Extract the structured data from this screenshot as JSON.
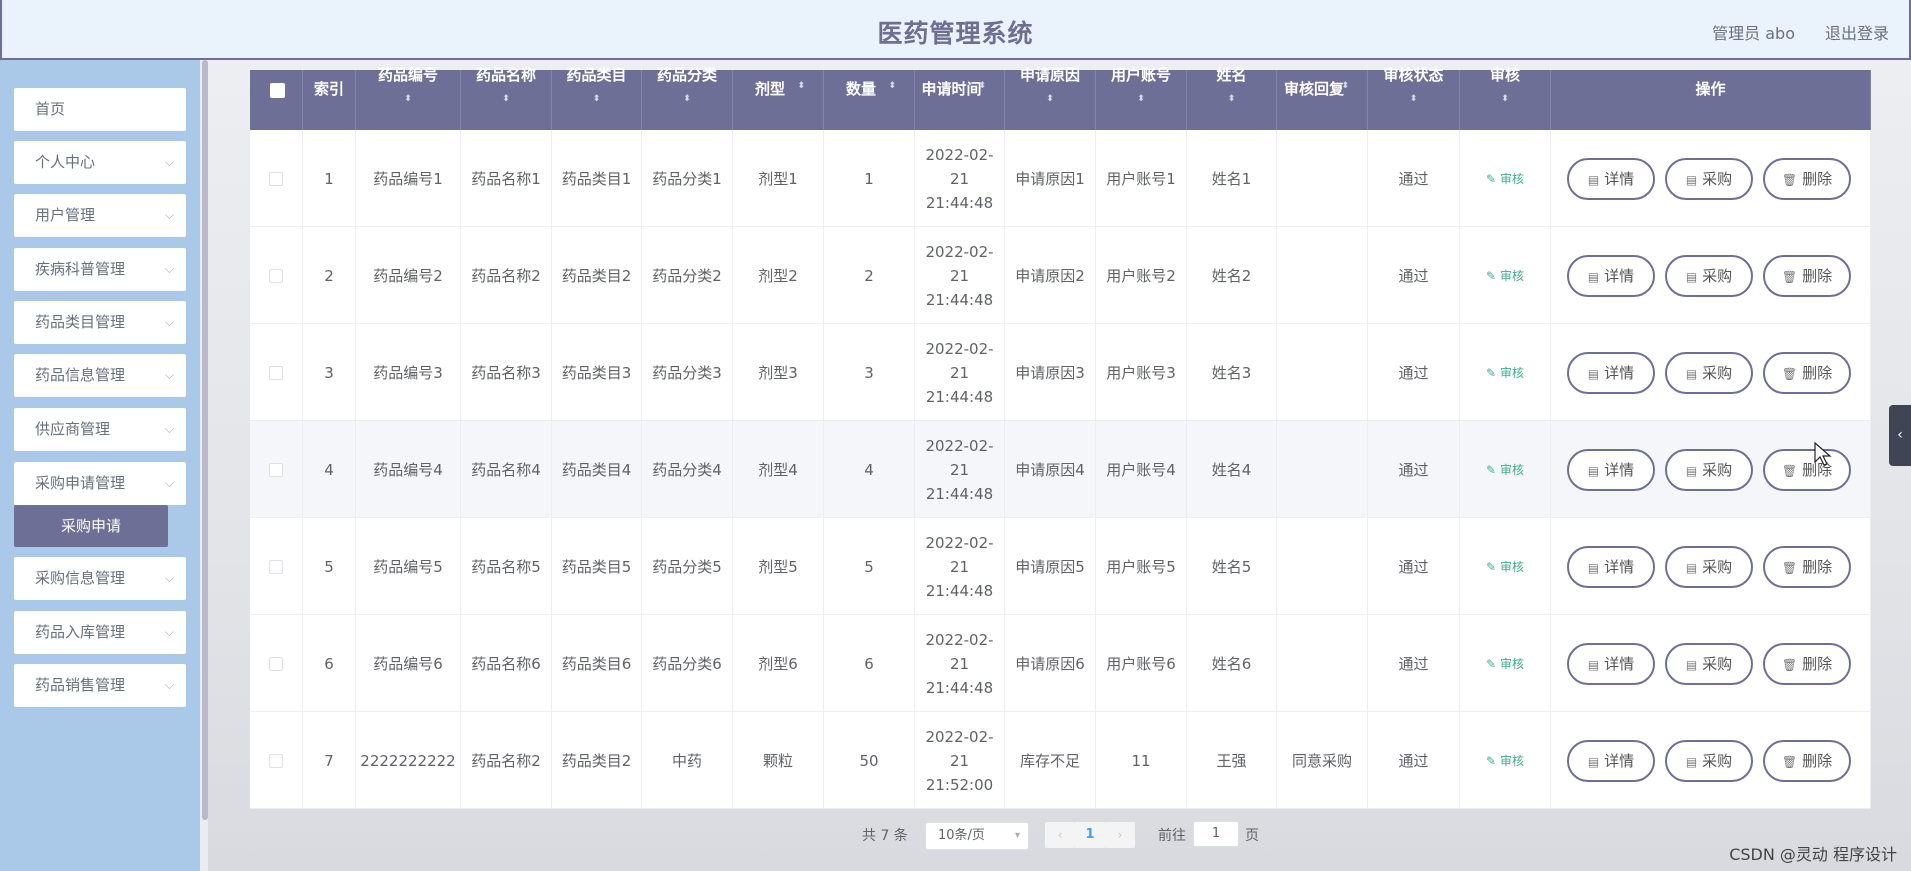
{
  "header": {
    "title": "医药管理系统",
    "user": "管理员 abo",
    "logout": "退出登录"
  },
  "sidebar": {
    "items": [
      {
        "label": "首页",
        "has_chevron": false
      },
      {
        "label": "个人中心",
        "has_chevron": true
      },
      {
        "label": "用户管理",
        "has_chevron": true
      },
      {
        "label": "疾病科普管理",
        "has_chevron": true
      },
      {
        "label": "药品类目管理",
        "has_chevron": true
      },
      {
        "label": "药品信息管理",
        "has_chevron": true
      },
      {
        "label": "供应商管理",
        "has_chevron": true
      },
      {
        "label": "采购申请管理",
        "has_chevron": true
      },
      {
        "label": "采购信息管理",
        "has_chevron": true
      },
      {
        "label": "药品入库管理",
        "has_chevron": true
      },
      {
        "label": "药品销售管理",
        "has_chevron": true
      }
    ],
    "active_sub": "采购申请"
  },
  "table": {
    "columns": [
      {
        "label": "索引",
        "sortable": false
      },
      {
        "label": "药品编号",
        "sortable": true
      },
      {
        "label": "药品名称",
        "sortable": true
      },
      {
        "label": "药品类目",
        "sortable": true
      },
      {
        "label": "药品分类",
        "sortable": true
      },
      {
        "label": "剂型",
        "sortable": true
      },
      {
        "label": "数量",
        "sortable": true
      },
      {
        "label": "申请时间",
        "sortable": true
      },
      {
        "label": "申请原因",
        "sortable": true
      },
      {
        "label": "用户账号",
        "sortable": true
      },
      {
        "label": "姓名",
        "sortable": true
      },
      {
        "label": "审核回复",
        "sortable": true
      },
      {
        "label": "审核状态",
        "sortable": true
      },
      {
        "label": "审核",
        "sortable": true
      },
      {
        "label": "操作",
        "sortable": false
      }
    ],
    "rows": [
      {
        "index": "1",
        "code": "药品编号1",
        "name": "药品名称1",
        "category": "药品类目1",
        "class": "药品分类1",
        "form": "剂型1",
        "qty": "1",
        "time": "2022-02-21 21:44:48",
        "reason": "申请原因1",
        "account": "用户账号1",
        "person": "姓名1",
        "reply": "",
        "status": "通过"
      },
      {
        "index": "2",
        "code": "药品编号2",
        "name": "药品名称2",
        "category": "药品类目2",
        "class": "药品分类2",
        "form": "剂型2",
        "qty": "2",
        "time": "2022-02-21 21:44:48",
        "reason": "申请原因2",
        "account": "用户账号2",
        "person": "姓名2",
        "reply": "",
        "status": "通过"
      },
      {
        "index": "3",
        "code": "药品编号3",
        "name": "药品名称3",
        "category": "药品类目3",
        "class": "药品分类3",
        "form": "剂型3",
        "qty": "3",
        "time": "2022-02-21 21:44:48",
        "reason": "申请原因3",
        "account": "用户账号3",
        "person": "姓名3",
        "reply": "",
        "status": "通过"
      },
      {
        "index": "4",
        "code": "药品编号4",
        "name": "药品名称4",
        "category": "药品类目4",
        "class": "药品分类4",
        "form": "剂型4",
        "qty": "4",
        "time": "2022-02-21 21:44:48",
        "reason": "申请原因4",
        "account": "用户账号4",
        "person": "姓名4",
        "reply": "",
        "status": "通过"
      },
      {
        "index": "5",
        "code": "药品编号5",
        "name": "药品名称5",
        "category": "药品类目5",
        "class": "药品分类5",
        "form": "剂型5",
        "qty": "5",
        "time": "2022-02-21 21:44:48",
        "reason": "申请原因5",
        "account": "用户账号5",
        "person": "姓名5",
        "reply": "",
        "status": "通过"
      },
      {
        "index": "6",
        "code": "药品编号6",
        "name": "药品名称6",
        "category": "药品类目6",
        "class": "药品分类6",
        "form": "剂型6",
        "qty": "6",
        "time": "2022-02-21 21:44:48",
        "reason": "申请原因6",
        "account": "用户账号6",
        "person": "姓名6",
        "reply": "",
        "status": "通过"
      },
      {
        "index": "7",
        "code": "2222222222",
        "name": "药品名称2",
        "category": "药品类目2",
        "class": "中药",
        "form": "颗粒",
        "qty": "50",
        "time": "2022-02-21 21:52:00",
        "reason": "库存不足",
        "account": "11",
        "person": "王强",
        "reply": "同意采购",
        "status": "通过"
      }
    ],
    "audit_label": "审核",
    "actions": {
      "detail": "详情",
      "purchase": "采购",
      "delete": "删除"
    }
  },
  "pager": {
    "total": "共 7 条",
    "page_size": "10条/页",
    "current": "1",
    "goto_label": "前往",
    "goto_value": "1",
    "goto_suffix": "页"
  },
  "watermark": "CSDN @灵动 程序设计",
  "colors": {
    "accent": "#6e6f97",
    "sidebar": "#aac8e7",
    "header_bg": "#eaf3fb",
    "audit_green": "#3bb08d"
  }
}
